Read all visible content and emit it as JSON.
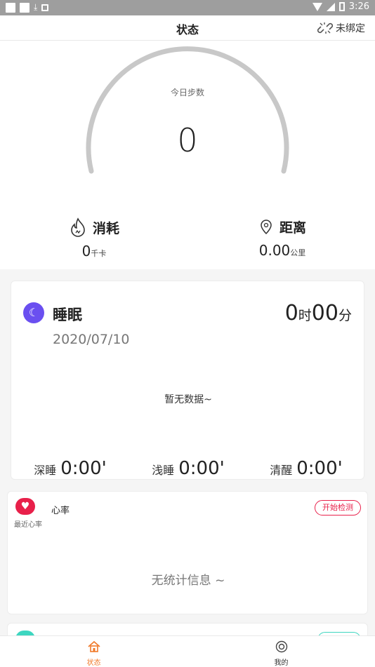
{
  "status_bar": {
    "time": "3:26"
  },
  "header": {
    "title": "状态",
    "unbound_label": "未绑定"
  },
  "steps": {
    "label": "今日步数",
    "value": "0"
  },
  "calories": {
    "label": "消耗",
    "value": "0",
    "unit": "千卡"
  },
  "distance": {
    "label": "距离",
    "value": "0.00",
    "unit": "公里"
  },
  "sleep": {
    "title": "睡眠",
    "date": "2020/07/10",
    "hours": "0",
    "hours_unit": "时",
    "minutes": "00",
    "minutes_unit": "分",
    "no_data": "暂无数据~",
    "stats": [
      {
        "label": "深睡",
        "value": "0:00'"
      },
      {
        "label": "浅睡",
        "value": "0:00'"
      },
      {
        "label": "清醒",
        "value": "0:00'"
      }
    ]
  },
  "heart_rate": {
    "title": "心率",
    "subtitle": "最近心率",
    "detect_button": "开始检测",
    "no_data": "无统计信息 ~"
  },
  "tabs": [
    {
      "label": "状态",
      "icon": "home-icon",
      "active": true
    },
    {
      "label": "我的",
      "icon": "profile-icon",
      "active": false
    }
  ],
  "colors": {
    "accent": "#f07a2a",
    "sleep_icon": "#6a4ff0",
    "heart": "#e8204a",
    "gauge_track": "#c8c8c8"
  }
}
